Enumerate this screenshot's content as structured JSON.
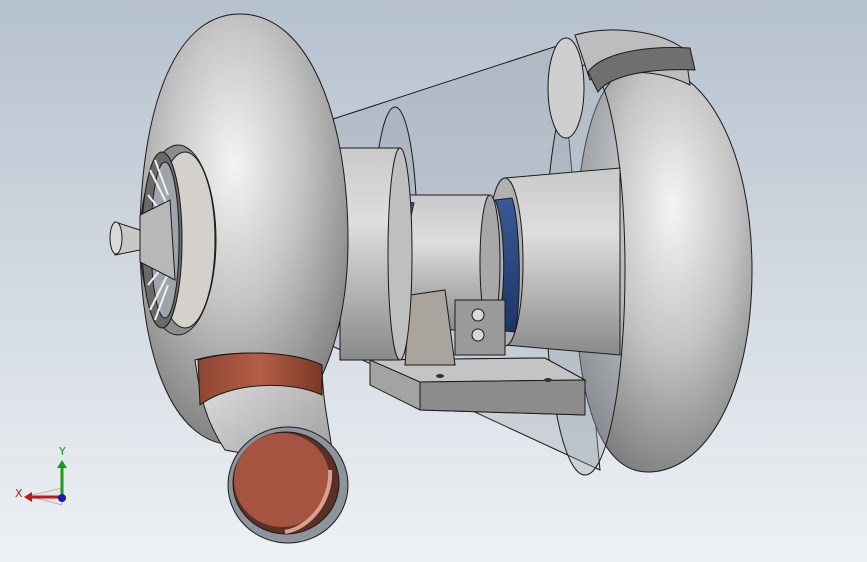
{
  "viewport": {
    "background_top": "#b6c1ce",
    "background_bottom": "#eef1f4"
  },
  "model": {
    "body_color": "#b9b9b9",
    "body_highlight": "#f2f2f2",
    "body_shadow": "#7e7e7e",
    "outline_color": "#1a1a1a",
    "copper_color": "#a8553f",
    "copper_dark": "#6e3224",
    "bearing_color": "#2e4d88",
    "shroud_color": "#8f9aa6"
  },
  "triad": {
    "x_label": "X",
    "y_label": "Y",
    "x_color": "#c01818",
    "y_color": "#1c9a1c",
    "z_color": "#1818c0"
  }
}
